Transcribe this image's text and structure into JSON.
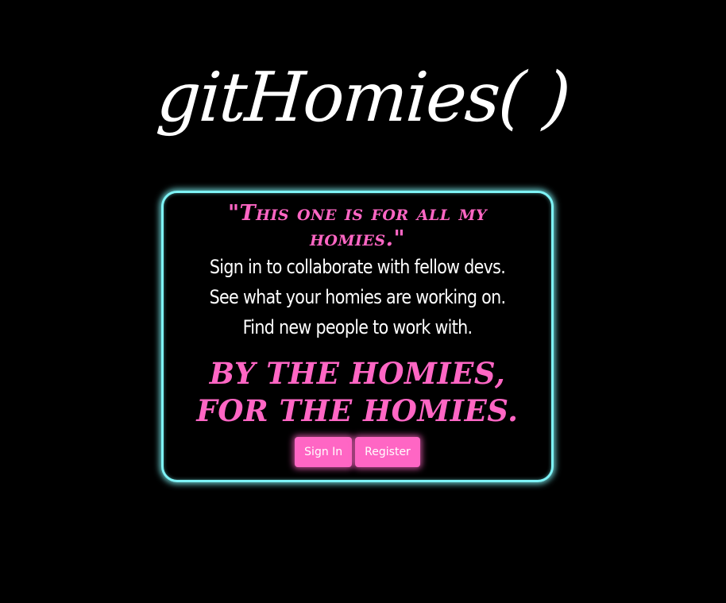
{
  "header": {
    "logo_text": "gitHomies( )"
  },
  "card": {
    "quote": "\"This one is for all my homies.\"",
    "lines": [
      "Sign in to collaborate with fellow devs.",
      "See what your homies are working on.",
      "Find new people to work with."
    ],
    "slogan": "By the homies, for the homies."
  },
  "buttons": {
    "sign_in_label": "Sign In",
    "register_label": "Register"
  },
  "colors": {
    "background": "#000000",
    "accent_pink": "#ff66c4",
    "card_border_cyan": "#7ef3f6",
    "text_white": "#ffffff"
  }
}
